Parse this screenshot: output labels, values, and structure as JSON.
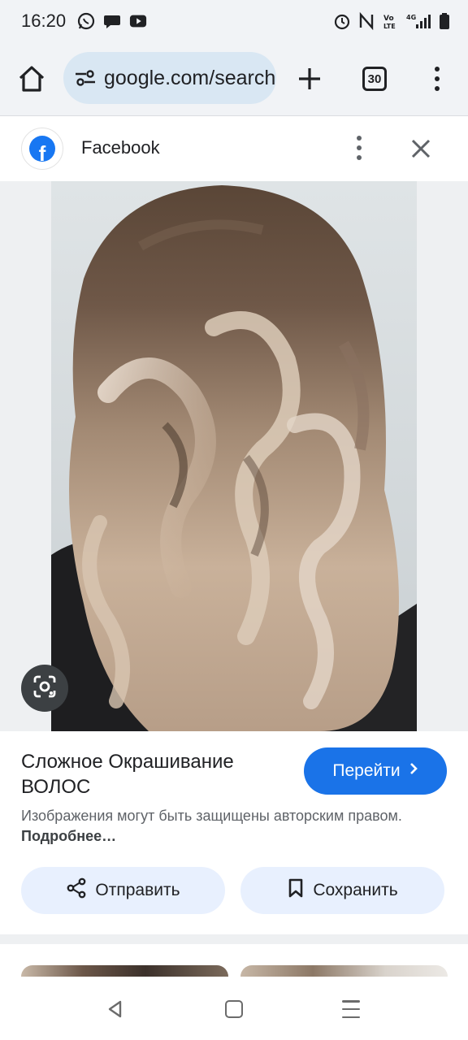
{
  "status_bar": {
    "time": "16:20",
    "left_icons": [
      "whatsapp-icon",
      "messages-icon",
      "youtube-icon"
    ],
    "right_icons": [
      "alarm-icon",
      "nfc-icon",
      "volte-icon",
      "signal-4g-icon",
      "battery-icon"
    ],
    "network": "4G"
  },
  "toolbar": {
    "url": "google.com/search",
    "tab_count": "30"
  },
  "source": {
    "name": "Facebook",
    "logo_letter": "f",
    "brand_color": "#1877f2"
  },
  "result": {
    "title": "Сложное Окрашивание ВОЛОС",
    "visit_label": "Перейти",
    "copyright_text": "Изображения могут быть защищены авторским правом.",
    "copyright_link": "Подробнее…",
    "share_label": "Отправить",
    "save_label": "Сохранить",
    "accent_color": "#1a73e8"
  }
}
